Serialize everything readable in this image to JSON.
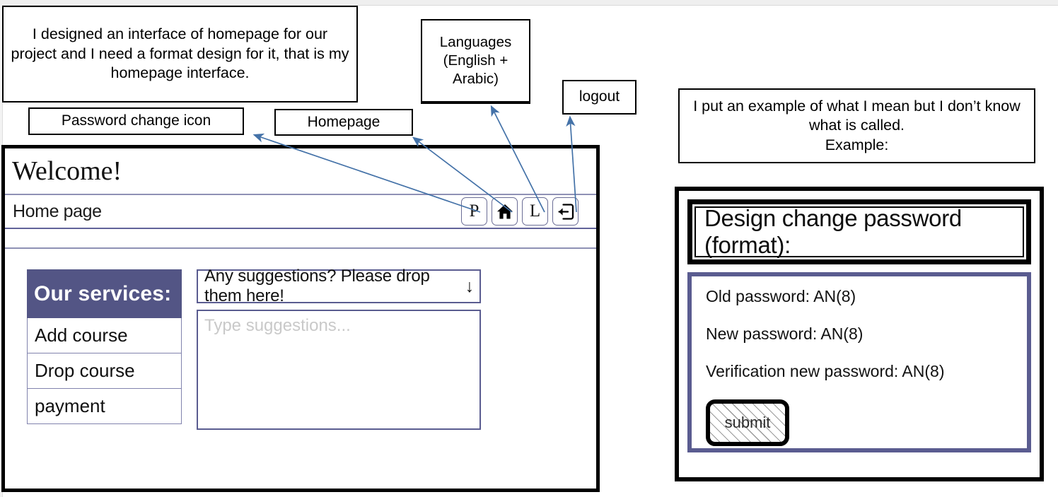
{
  "annotations": {
    "intro": "I designed an interface of homepage for our project and I need a format design for it, that is my homepage interface.",
    "password_change": "Password change icon",
    "homepage": "Homepage",
    "languages": "Languages (English + Arabic)",
    "logout": "logout",
    "example": "I put an example of what I mean but I don’t know what is called.\nExample:"
  },
  "mock_window": {
    "title": "Welcome!",
    "breadcrumb": "Home page",
    "nav_buttons": [
      {
        "name": "password-change-button",
        "icon": "letter-p-icon",
        "label": "P"
      },
      {
        "name": "homepage-button",
        "icon": "home-icon",
        "label": ""
      },
      {
        "name": "language-button",
        "icon": "letter-l-icon",
        "label": "L"
      },
      {
        "name": "logout-button",
        "icon": "logout-icon",
        "label": ""
      }
    ],
    "services": {
      "header": "Our services:",
      "items": [
        "Add course",
        "Drop course",
        "payment"
      ]
    },
    "suggestions": {
      "prompt": "Any suggestions? Please drop them here!",
      "prompt_arrow": "↓",
      "placeholder": "Type suggestions..."
    }
  },
  "example_panel": {
    "title": "Design change password (format):",
    "fields": [
      "Old password: AN(8)",
      "New password: AN(8)",
      "Verification new password: AN(8)"
    ],
    "submit_label": "submit"
  },
  "colors": {
    "accent_purple": "#535585",
    "border_purple": "#5a5c90",
    "arrow_blue": "#4472a8",
    "frame_black": "#000000"
  }
}
